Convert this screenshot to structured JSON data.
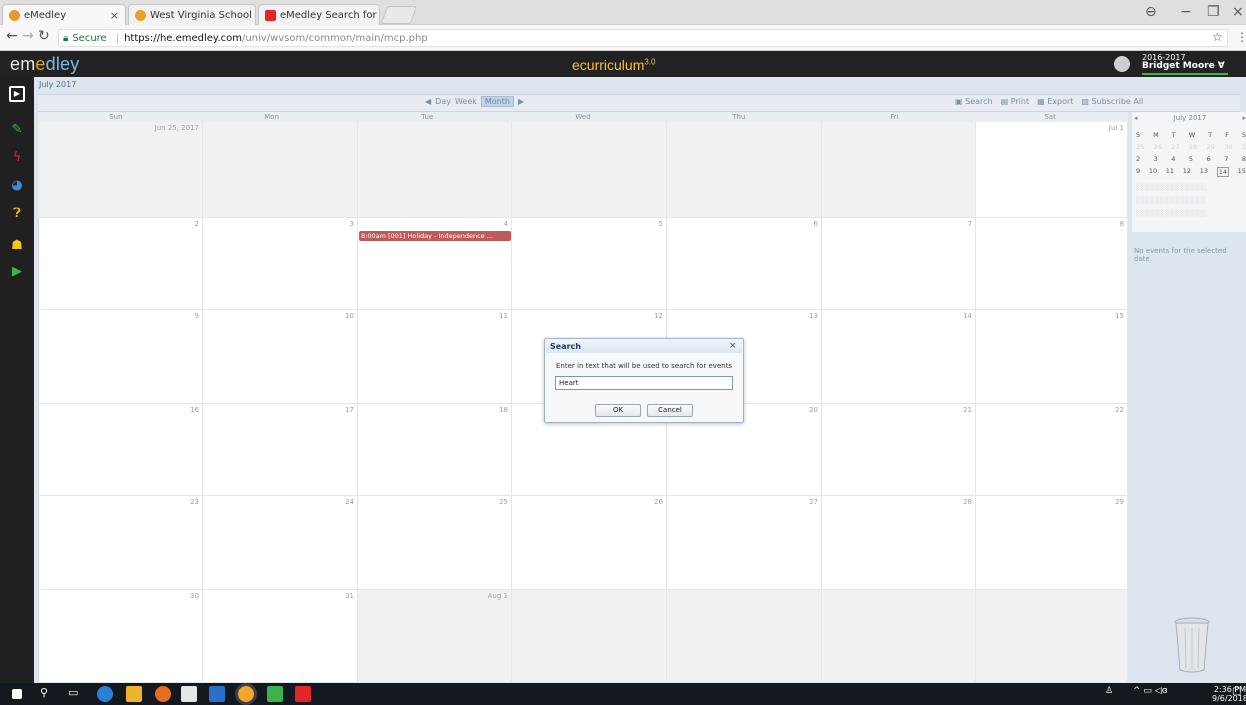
{
  "browser": {
    "tabs": [
      {
        "label": "eMedley"
      },
      {
        "label": "West Virginia School of"
      },
      {
        "label": "eMedley Search for Prev"
      }
    ],
    "secure_label": "Secure",
    "url_host": "https://he.emedley.com",
    "url_path": "/univ/wvsom/common/main/mcp.php"
  },
  "app": {
    "logo_em": "em",
    "logo_e": "e",
    "logo_dley": "dley",
    "title": "ecurriculum",
    "title_sup": "3.0",
    "user_year": "2016-2017",
    "user_name": "Bridget Moore ∀"
  },
  "calendar": {
    "month_label": "July 2017",
    "nav": {
      "prev": "◀",
      "day": "Day",
      "week": "Week",
      "month": "Month",
      "next": "▶"
    },
    "actions": {
      "search": "Search",
      "print": "Print",
      "export": "Export",
      "subscribe": "Subscribe All"
    },
    "days": [
      "Sun",
      "Mon",
      "Tue",
      "Wed",
      "Thu",
      "Fri",
      "Sat"
    ],
    "weeks": [
      [
        "Jun 25, 2017",
        "",
        "",
        "",
        "",
        "",
        "Jul 1"
      ],
      [
        "2",
        "3",
        "4",
        "5",
        "6",
        "7",
        "8"
      ],
      [
        "9",
        "10",
        "11",
        "12",
        "13",
        "14",
        "15"
      ],
      [
        "16",
        "17",
        "18",
        "19",
        "20",
        "21",
        "22"
      ],
      [
        "23",
        "24",
        "25",
        "26",
        "27",
        "28",
        "29"
      ],
      [
        "30",
        "31",
        "Aug 1",
        "",
        "",
        "",
        ""
      ]
    ],
    "event": "8:00am [001] Holiday - Independence ...",
    "mini": {
      "header": "July 2017",
      "dow": [
        "S",
        "M",
        "T",
        "W",
        "T",
        "F",
        "S"
      ],
      "rows": [
        [
          "25",
          "26",
          "27",
          "28",
          "29",
          "30",
          "1"
        ],
        [
          "2",
          "3",
          "4",
          "5",
          "6",
          "7",
          "8"
        ],
        [
          "9",
          "10",
          "11",
          "12",
          "13",
          "14",
          "15"
        ]
      ],
      "today": "14"
    },
    "no_events": "No events for the selected date."
  },
  "dialog": {
    "title": "Search",
    "close": "×",
    "prompt": "Enter in text that will be used to search for events",
    "input_value": "Heart",
    "ok": "OK",
    "cancel": "Cancel"
  },
  "taskbar": {
    "time": "2:36 PM",
    "date": "9/6/2018"
  }
}
